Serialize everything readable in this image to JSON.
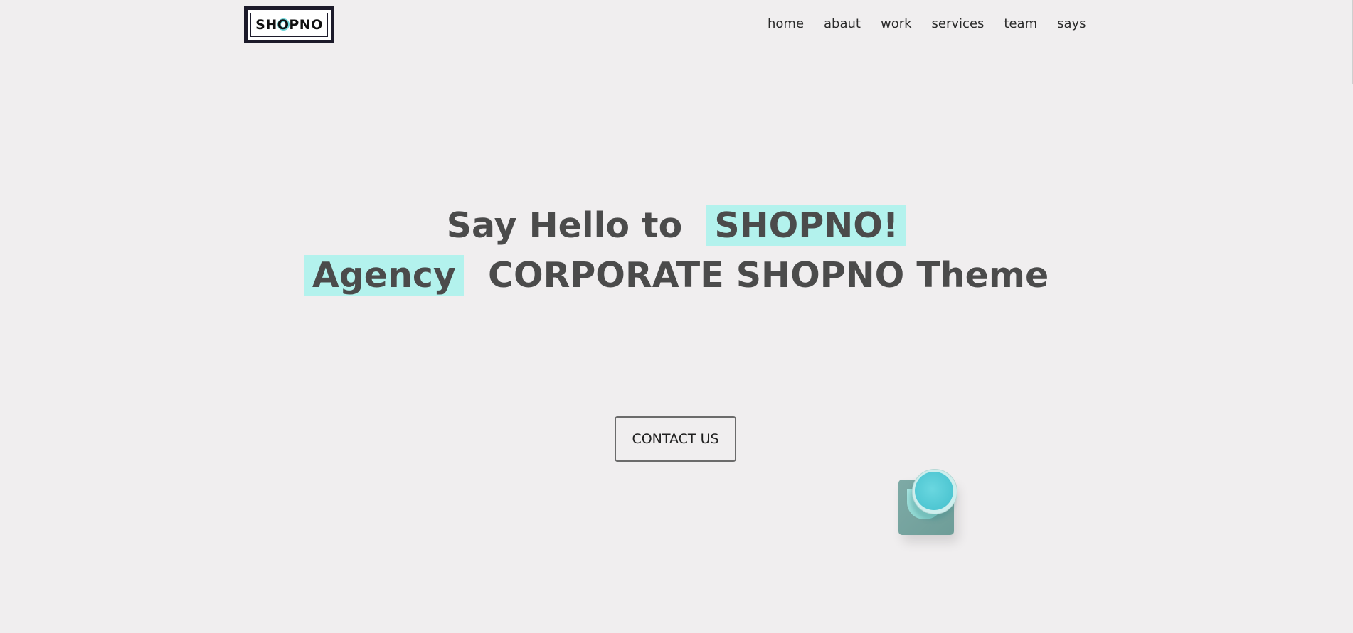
{
  "brand": {
    "logo_text": "SHOPNO"
  },
  "nav": {
    "items": [
      "home",
      "abaut",
      "work",
      "services",
      "team",
      "says"
    ]
  },
  "hero": {
    "line1_plain": "Say Hello to",
    "line1_highlight": "SHOPNO!",
    "line2_highlight": "Agency",
    "line2_plain": "CORPORATE SHOPNO Theme"
  },
  "cta": {
    "label": "CONTACT US"
  },
  "colors": {
    "background": "#f0eeef",
    "highlight": "#b3f2ed",
    "heading": "#4b4b4b",
    "logo_accent": "#6fd6d8"
  }
}
